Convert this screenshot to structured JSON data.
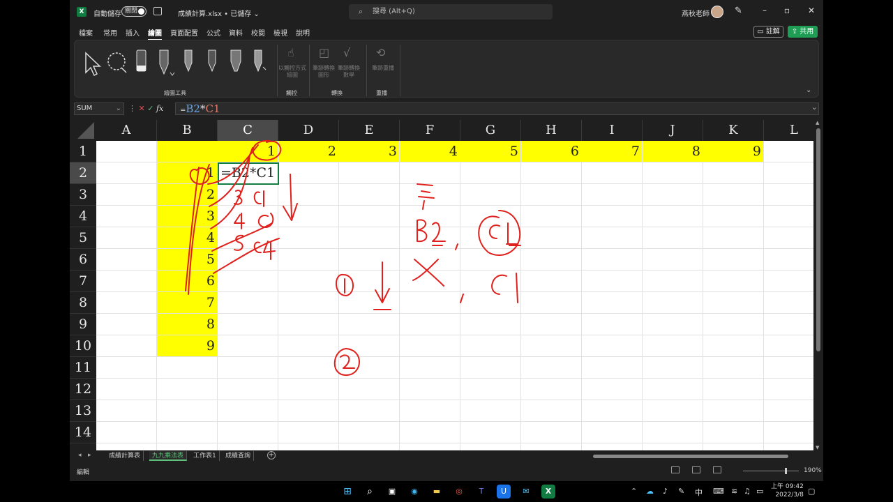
{
  "titlebar": {
    "app_icon": "excel-icon",
    "autosave_label": "自動儲存",
    "autosave_state": "關閉",
    "doc_title": "成績計算.xlsx • 已儲存 ⌄",
    "search_placeholder": "搜尋 (Alt+Q)",
    "user_name": "燕秋老師"
  },
  "menu": {
    "tabs": [
      "檔案",
      "常用",
      "插入",
      "繪圖",
      "頁面配置",
      "公式",
      "資料",
      "校閱",
      "檢視",
      "說明"
    ],
    "active": "繪圖",
    "comment_label": "註解",
    "share_label": "共用"
  },
  "ribbon": {
    "groups": [
      "繪圖工具",
      "觸控",
      "轉換",
      "重播"
    ],
    "touch_tool": "以觸控方式繪圖",
    "convert_tools": [
      "筆跡轉換圖形",
      "筆跡轉換數學"
    ],
    "replay_tool": "筆跡重播"
  },
  "formula_bar": {
    "name_box": "SUM",
    "formula_eq": "=",
    "formula_ref1": "B2",
    "formula_op": "*",
    "formula_ref2": "C1"
  },
  "sheet": {
    "columns": [
      "A",
      "B",
      "C",
      "D",
      "E",
      "F",
      "G",
      "H",
      "I",
      "J",
      "K",
      "L"
    ],
    "selected_column": "C",
    "rows": [
      "1",
      "2",
      "3",
      "4",
      "5",
      "6",
      "7",
      "8",
      "9",
      "10",
      "11",
      "12",
      "13",
      "14"
    ],
    "selected_row": "2",
    "row1_values": [
      "1",
      "2",
      "3",
      "4",
      "5",
      "6",
      "7",
      "8",
      "9"
    ],
    "colB_values": [
      "1",
      "2",
      "3",
      "4",
      "5",
      "6",
      "7",
      "8",
      "9"
    ],
    "editing_cell_text": "=B2*C1",
    "highlight_color": "#ffff00",
    "ink_color": "#e0201c"
  },
  "sheet_tabs": [
    "成績計算表",
    "九九乘法表",
    "工作表1",
    "成績查詢"
  ],
  "active_sheet": "九九乘法表",
  "status": {
    "mode": "編輯",
    "zoom": "190%"
  },
  "taskbar": {
    "time": "上午 09:42",
    "date": "2022/3/8",
    "ime": "中"
  }
}
